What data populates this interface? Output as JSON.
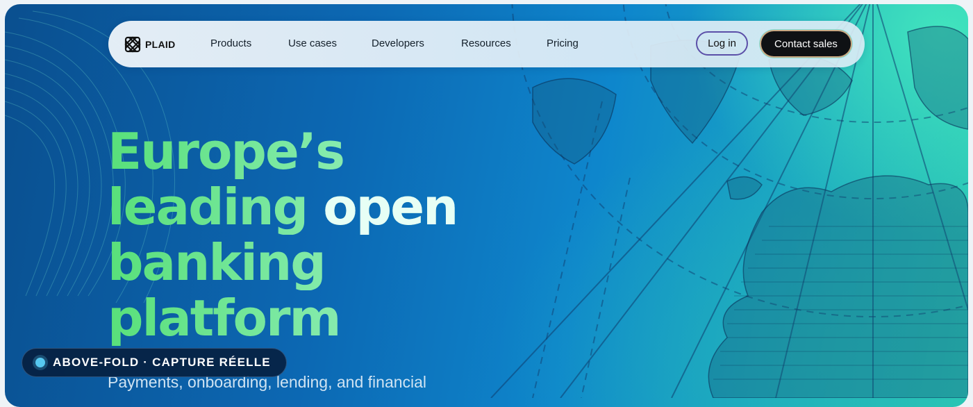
{
  "brand": {
    "name": "PLAID",
    "icon": "plaid-logo-icon"
  },
  "nav": {
    "items": [
      "Products",
      "Use cases",
      "Developers",
      "Resources",
      "Pricing"
    ],
    "login_label": "Log in",
    "contact_label": "Contact sales"
  },
  "hero": {
    "line1": "Europe’s",
    "line2a": "leading",
    "line2b": "open",
    "line3": "banking",
    "line4": "platform",
    "subtitle": "Payments, onboarding, lending, and financial"
  },
  "badge": {
    "text": "ABOVE-FOLD · CAPTURE RÉELLE",
    "dot_color": "#56c8f0"
  },
  "colors": {
    "accent_green": "#58e07a",
    "background_blue": "#0c68b3",
    "teal": "#2cc9b4",
    "button_dark": "#0f1114"
  }
}
